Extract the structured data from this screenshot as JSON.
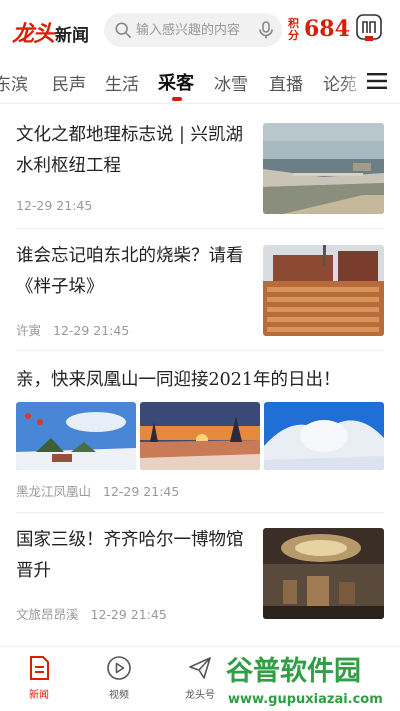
{
  "header": {
    "logo_mark": "龙头",
    "logo_text": "新闻",
    "search_placeholder": "输入感兴趣的内容",
    "points_label": "积分",
    "points_value": "684"
  },
  "tabs": [
    {
      "label": "东滨"
    },
    {
      "label": "民声"
    },
    {
      "label": "生活"
    },
    {
      "label": "采客"
    },
    {
      "label": "冰雪"
    },
    {
      "label": "直播"
    },
    {
      "label": "论苑"
    }
  ],
  "articles": [
    {
      "title": "文化之都地理标志说 | 兴凯湖水利枢纽工程",
      "source": "",
      "time": "12-29 21:45"
    },
    {
      "title": "谁会忘记咱东北的烧柴？请看《柈子垛》",
      "source": "许寅",
      "time": "12-29 21:45"
    },
    {
      "title": "亲，快来凤凰山一同迎接2021年的日出！",
      "source": "黑龙江凤凰山",
      "time": "12-29 21:45"
    },
    {
      "title": "国家三级！齐齐哈尔一博物馆晋升",
      "source": "文旅昂昂溪",
      "time": "12-29 21:45"
    }
  ],
  "bottom_nav": [
    {
      "label": "新闻",
      "icon": "news-icon"
    },
    {
      "label": "视频",
      "icon": "video-play-icon"
    },
    {
      "label": "龙头号",
      "icon": "paper-plane-icon"
    }
  ],
  "watermark": {
    "brand": "谷普软件园",
    "url": "www.gupuxiazai.com"
  },
  "colors": {
    "accent": "#d81e06",
    "text": "#222222",
    "meta": "#999999"
  }
}
